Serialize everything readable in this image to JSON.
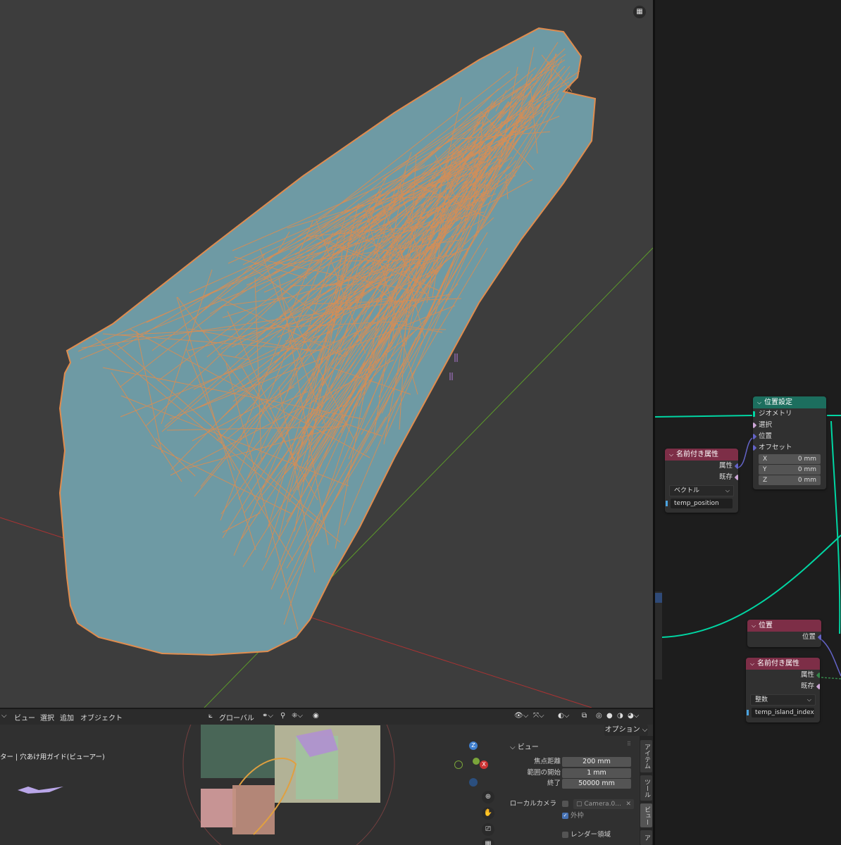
{
  "viewport_toolbar": {
    "menus": [
      "ビュー",
      "選択",
      "追加",
      "オブジェクト"
    ],
    "orientation": "グローバル",
    "options_label": "オプション"
  },
  "viewport_overlay": {
    "camera_label": "ター | 穴あけ用ガイド(ビューアー)"
  },
  "view_panel": {
    "header": "ビュー",
    "focal_length_label": "焦点距離",
    "focal_length_value": "200 mm",
    "clip_start_label": "範囲の開始",
    "clip_start_value": "1 mm",
    "clip_end_label": "終了",
    "clip_end_value": "50000 mm",
    "local_camera_label": "ローカルカメラ",
    "local_camera_value": "Camera.0...",
    "frame_label": "外枠",
    "render_region_label": "レンダー領域"
  },
  "side_tabs": [
    "アイテム",
    "ツール",
    "ビュー",
    "ア"
  ],
  "nodes": {
    "set_position": {
      "title": "位置設定",
      "geometry": "ジオメトリ",
      "selection": "選択",
      "position": "位置",
      "offset": "オフセット",
      "x_label": "X",
      "x_value": "0 mm",
      "y_label": "Y",
      "y_value": "0 mm",
      "z_label": "Z",
      "z_value": "0 mm"
    },
    "named_attr_1": {
      "title": "名前付き属性",
      "attribute": "属性",
      "exists": "既存",
      "type": "ベクトル",
      "name": "temp_position"
    },
    "position": {
      "title": "位置",
      "output": "位置"
    },
    "named_attr_2": {
      "title": "名前付き属性",
      "attribute": "属性",
      "exists": "既存",
      "type": "整数",
      "name": "temp_island_index"
    }
  },
  "colors": {
    "viewport_bg": "#3d3d3d",
    "mesh_fill": "#6e9aa4",
    "wire": "#e08c4e",
    "geo_header": "#1c6e5e",
    "attr_header": "#7d2e47",
    "wire_geo": "#00d6a3"
  }
}
